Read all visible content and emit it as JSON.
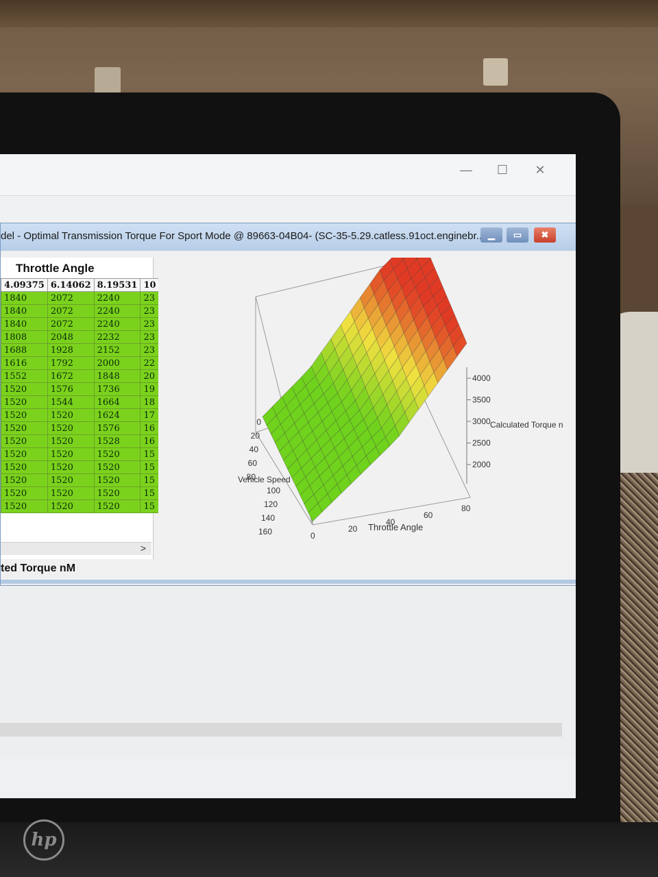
{
  "outer_window": {
    "controls": {
      "minimize": "—",
      "maximize": "☐",
      "close": "✕"
    }
  },
  "inner_window": {
    "title": "del - Optimal Transmission Torque For Sport Mode @ 89663-04B04- (SC-35-5.29.catless.91oct.enginebr...",
    "controls": {
      "minimize": "▁",
      "maximize": "▭",
      "close": "✖"
    }
  },
  "table": {
    "title": "Throttle Angle",
    "headers": [
      "4.09375",
      "6.14062",
      "8.19531",
      "10"
    ],
    "rows": [
      [
        "1840",
        "2072",
        "2240",
        "23"
      ],
      [
        "1840",
        "2072",
        "2240",
        "23"
      ],
      [
        "1840",
        "2072",
        "2240",
        "23"
      ],
      [
        "1808",
        "2048",
        "2232",
        "23"
      ],
      [
        "1688",
        "1928",
        "2152",
        "23"
      ],
      [
        "1616",
        "1792",
        "2000",
        "22"
      ],
      [
        "1552",
        "1672",
        "1848",
        "20"
      ],
      [
        "1520",
        "1576",
        "1736",
        "19"
      ],
      [
        "1520",
        "1544",
        "1664",
        "18"
      ],
      [
        "1520",
        "1520",
        "1624",
        "17"
      ],
      [
        "1520",
        "1520",
        "1576",
        "16"
      ],
      [
        "1520",
        "1520",
        "1528",
        "16"
      ],
      [
        "1520",
        "1520",
        "1520",
        "15"
      ],
      [
        "1520",
        "1520",
        "1520",
        "15"
      ],
      [
        "1520",
        "1520",
        "1520",
        "15"
      ],
      [
        "1520",
        "1520",
        "1520",
        "15"
      ],
      [
        "1520",
        "1520",
        "1520",
        "15"
      ]
    ],
    "scroll_arrow": ">",
    "bottom_label": "ted Torque nM"
  },
  "chart_data": {
    "type": "surface",
    "x_axis": {
      "label": "Throttle Angle",
      "ticks": [
        "0",
        "20",
        "40",
        "60",
        "80"
      ]
    },
    "y_axis": {
      "label": "Vehicle Speed",
      "ticks": [
        "0",
        "20",
        "40",
        "60",
        "80",
        "100",
        "120",
        "140",
        "160"
      ]
    },
    "z_axis": {
      "label": "Calculated Torque n",
      "ticks": [
        "2000",
        "2500",
        "3000",
        "3500",
        "4000"
      ]
    },
    "colors": {
      "low": "#6fd21c",
      "mid": "#f0e040",
      "high": "#e03a24"
    }
  },
  "brand": {
    "logo_text": "hp"
  }
}
